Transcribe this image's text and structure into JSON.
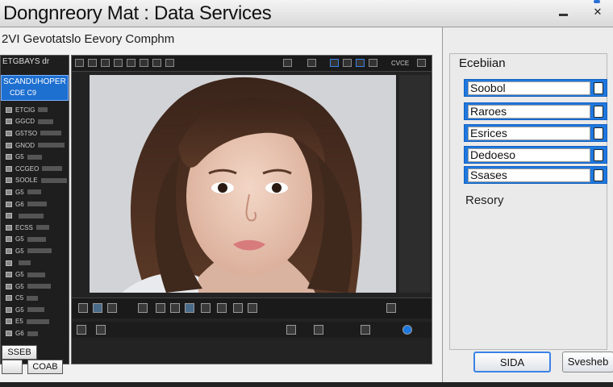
{
  "window": {
    "title": "Dongnreory Mat : Data Services",
    "close_glyph": "✕"
  },
  "workspace": {
    "subtitle": "2VI Gevotatslo Eevory Comphm"
  },
  "left_panel": {
    "header": "ETGBAYS dr",
    "selected": {
      "line1": "SCANDUHOPER",
      "line2": "CDE C9"
    },
    "items": [
      {
        "label": "ETCIG"
      },
      {
        "label": "GGCD"
      },
      {
        "label": "G5TSO"
      },
      {
        "label": "GNOD"
      },
      {
        "label": "G5"
      },
      {
        "label": "CCGEO"
      },
      {
        "label": "SOOLE"
      },
      {
        "label": "G5"
      },
      {
        "label": "G6"
      },
      {
        "label": ""
      },
      {
        "label": "ECSS"
      },
      {
        "label": "G5"
      },
      {
        "label": "G5"
      },
      {
        "label": ""
      },
      {
        "label": "G5"
      },
      {
        "label": "G5"
      },
      {
        "label": "C5"
      },
      {
        "label": "G5"
      },
      {
        "label": "E5"
      },
      {
        "label": "G6"
      }
    ]
  },
  "viewer": {
    "toolbar_right_label": "CVCE",
    "photo_alt": "portrait photo"
  },
  "left_bottom": {
    "btn1": "SSEB",
    "btn2": "COAB"
  },
  "dialog": {
    "heading": "Ecebiian",
    "fields": [
      {
        "label": "Soobol"
      },
      {
        "label": "Raroes"
      },
      {
        "label": "Esrices"
      },
      {
        "label": "Dedoeso"
      },
      {
        "label": "Ssases"
      }
    ],
    "footer_label": "Resory",
    "primary_button": "SIDA",
    "secondary_button": "Svesheb"
  },
  "colors": {
    "accent": "#1e78e0",
    "dark_panel": "#1e1e1e"
  }
}
